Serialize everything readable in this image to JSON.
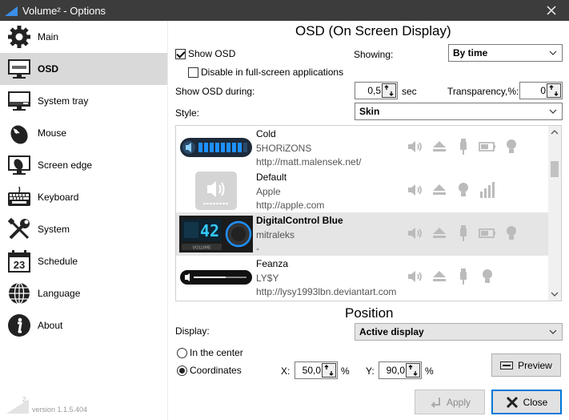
{
  "window": {
    "title": "Volume² - Options"
  },
  "sidebar": {
    "items": [
      {
        "label": "Main",
        "icon": "gear-icon",
        "active": false
      },
      {
        "label": "OSD",
        "icon": "monitor-icon",
        "active": true
      },
      {
        "label": "System tray",
        "icon": "tray-icon",
        "active": false
      },
      {
        "label": "Mouse",
        "icon": "mouse-icon",
        "active": false
      },
      {
        "label": "Screen edge",
        "icon": "screen-edge-icon",
        "active": false
      },
      {
        "label": "Keyboard",
        "icon": "keyboard-icon",
        "active": false
      },
      {
        "label": "System",
        "icon": "tools-icon",
        "active": false
      },
      {
        "label": "Schedule",
        "icon": "calendar-icon",
        "active": false
      },
      {
        "label": "Language",
        "icon": "globe-icon",
        "active": false
      },
      {
        "label": "About",
        "icon": "info-icon",
        "active": false
      }
    ],
    "calendar_day": "23",
    "version": "version 1.1.5.404"
  },
  "osd": {
    "title": "OSD (On Screen Display)",
    "show_osd_label": "Show OSD",
    "show_osd_checked": true,
    "disable_fullscreen_label": "Disable in full-screen applications",
    "disable_fullscreen_checked": false,
    "showing_label": "Showing:",
    "showing_value": "By time",
    "show_during_label": "Show OSD during:",
    "show_during_value": "0,5",
    "sec_label": "sec",
    "transparency_label": "Transparency,%:",
    "transparency_value": "0",
    "style_label": "Style:",
    "style_value": "Skin"
  },
  "skins": [
    {
      "name": "Cold",
      "author": "5HORiZONS",
      "url": "http://matt.malensek.net/",
      "selected": false
    },
    {
      "name": "Default",
      "author": "Apple",
      "url": "http://apple.com",
      "selected": false
    },
    {
      "name": "DigitalControl Blue",
      "author": "mitraleks",
      "url": "-",
      "selected": true,
      "thumb_number": "42",
      "thumb_label": "VOLUME"
    },
    {
      "name": "Feanza",
      "author": "LY$Y",
      "url": "http://lysy1993lbn.deviantart.com",
      "selected": false
    }
  ],
  "position": {
    "title": "Position",
    "display_label": "Display:",
    "display_value": "Active display",
    "center_label": "In the center",
    "coordinates_label": "Coordinates",
    "mode": "coordinates",
    "x_label": "X:",
    "x_value": "50,0",
    "y_label": "Y:",
    "y_value": "90,0",
    "percent": "%"
  },
  "buttons": {
    "preview": "Preview",
    "apply": "Apply",
    "close": "Close"
  },
  "colors": {
    "titlebar": "#3c3c3c",
    "selection": "#e5e5e5",
    "accent": "#0078d7",
    "osd_blue": "#1e90ff"
  }
}
